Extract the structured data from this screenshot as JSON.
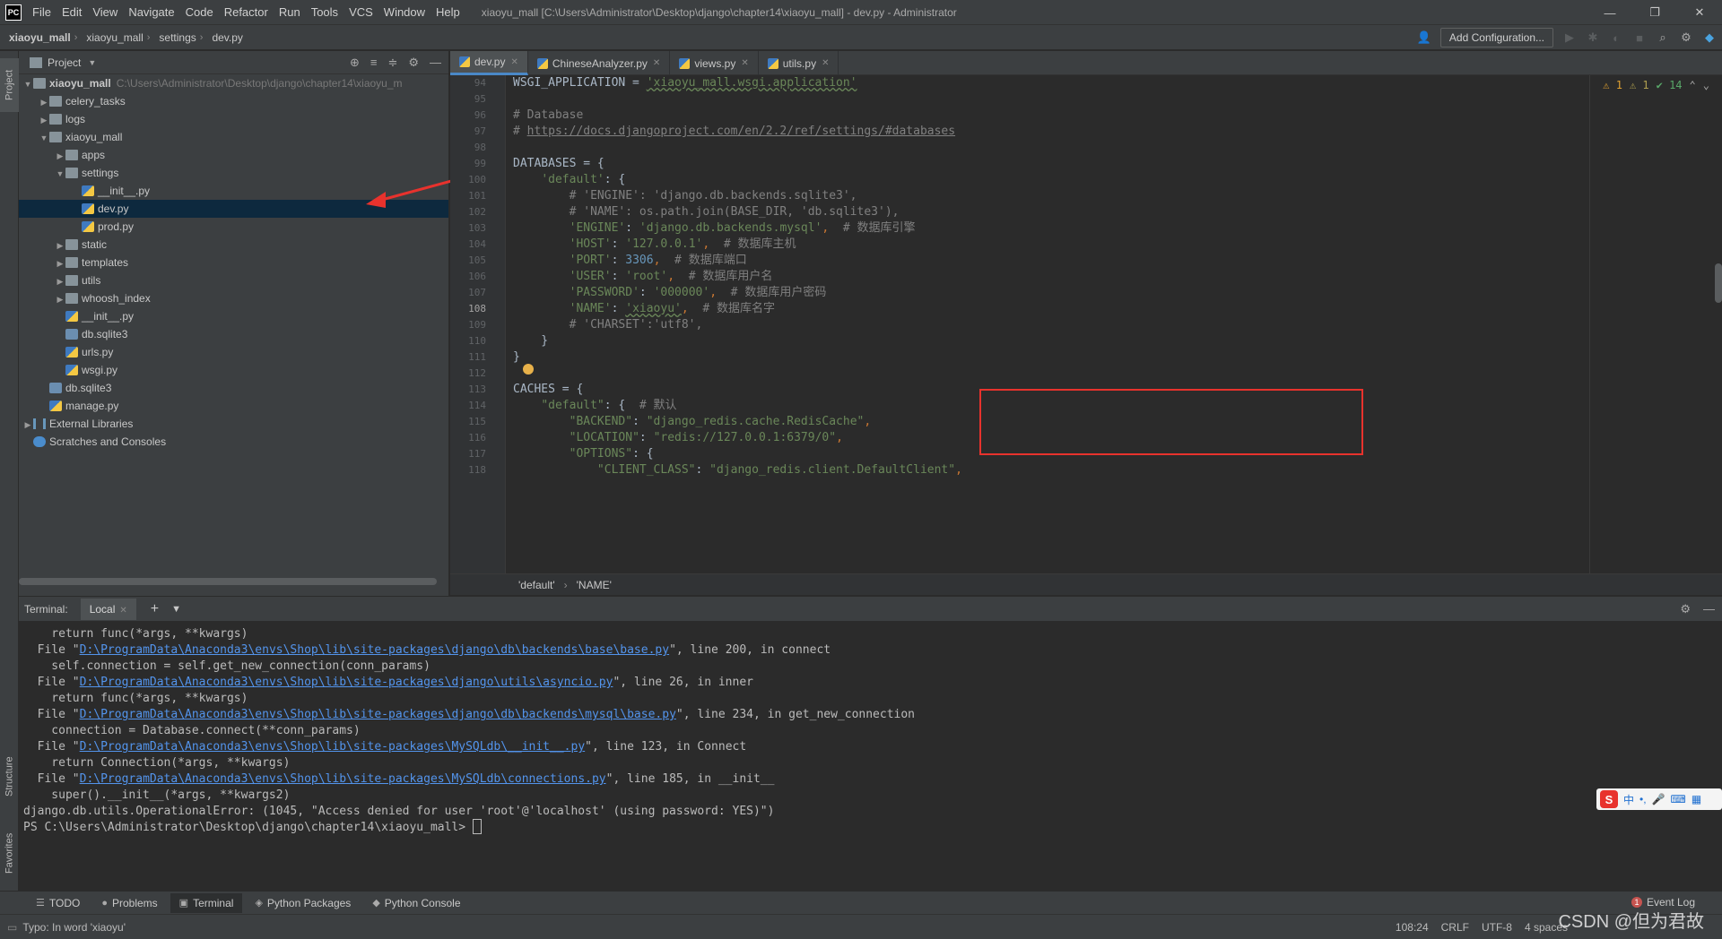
{
  "titlebar": {
    "menu": [
      "File",
      "Edit",
      "View",
      "Navigate",
      "Code",
      "Refactor",
      "Run",
      "Tools",
      "VCS",
      "Window",
      "Help"
    ],
    "window_title": "xiaoyu_mall [C:\\Users\\Administrator\\Desktop\\django\\chapter14\\xiaoyu_mall] - dev.py - Administrator",
    "logo": "PC"
  },
  "navbar": {
    "crumbs": [
      "xiaoyu_mall",
      "xiaoyu_mall",
      "settings",
      "dev.py"
    ],
    "add_configuration": "Add Configuration..."
  },
  "left_stripe": {
    "project": "Project",
    "structure": "Structure",
    "favorites": "Favorites"
  },
  "project": {
    "title": "Project",
    "root_path": "C:\\Users\\Administrator\\Desktop\\django\\chapter14\\xiaoyu_m",
    "tree": [
      {
        "label": "xiaoyu_mall",
        "depth": 0,
        "arrow": "down",
        "icon": "folder",
        "bold": true
      },
      {
        "label": "celery_tasks",
        "depth": 1,
        "arrow": "right",
        "icon": "folder"
      },
      {
        "label": "logs",
        "depth": 1,
        "arrow": "right",
        "icon": "folder"
      },
      {
        "label": "xiaoyu_mall",
        "depth": 1,
        "arrow": "down",
        "icon": "folder"
      },
      {
        "label": "apps",
        "depth": 2,
        "arrow": "right",
        "icon": "folder"
      },
      {
        "label": "settings",
        "depth": 2,
        "arrow": "down",
        "icon": "folder"
      },
      {
        "label": "__init__.py",
        "depth": 3,
        "arrow": "",
        "icon": "py"
      },
      {
        "label": "dev.py",
        "depth": 3,
        "arrow": "",
        "icon": "py",
        "selected": true
      },
      {
        "label": "prod.py",
        "depth": 3,
        "arrow": "",
        "icon": "py"
      },
      {
        "label": "static",
        "depth": 2,
        "arrow": "right",
        "icon": "folder"
      },
      {
        "label": "templates",
        "depth": 2,
        "arrow": "right",
        "icon": "folder"
      },
      {
        "label": "utils",
        "depth": 2,
        "arrow": "right",
        "icon": "folder"
      },
      {
        "label": "whoosh_index",
        "depth": 2,
        "arrow": "right",
        "icon": "folder"
      },
      {
        "label": "__init__.py",
        "depth": 2,
        "arrow": "",
        "icon": "py"
      },
      {
        "label": "db.sqlite3",
        "depth": 2,
        "arrow": "",
        "icon": "db"
      },
      {
        "label": "urls.py",
        "depth": 2,
        "arrow": "",
        "icon": "py"
      },
      {
        "label": "wsgi.py",
        "depth": 2,
        "arrow": "",
        "icon": "py"
      },
      {
        "label": "db.sqlite3",
        "depth": 1,
        "arrow": "",
        "icon": "db"
      },
      {
        "label": "manage.py",
        "depth": 1,
        "arrow": "",
        "icon": "py"
      },
      {
        "label": "External Libraries",
        "depth": 0,
        "arrow": "right",
        "icon": "lib"
      },
      {
        "label": "Scratches and Consoles",
        "depth": 0,
        "arrow": "",
        "icon": "scratch"
      }
    ]
  },
  "editor": {
    "tabs": [
      {
        "label": "dev.py",
        "active": true
      },
      {
        "label": "ChineseAnalyzer.py",
        "active": false
      },
      {
        "label": "views.py",
        "active": false
      },
      {
        "label": "utils.py",
        "active": false
      }
    ],
    "inspections": {
      "warnings": "1",
      "weak": "1",
      "ok": "14"
    },
    "current_line": "108",
    "lines": [
      {
        "n": "94",
        "segs": [
          [
            "WSGI_APPLICATION = ",
            ""
          ],
          [
            "'xiaoyu_mall.wsgi.application'",
            "str-u"
          ]
        ]
      },
      {
        "n": "95",
        "segs": []
      },
      {
        "n": "96",
        "segs": [
          [
            "# Database",
            "com"
          ]
        ]
      },
      {
        "n": "97",
        "segs": [
          [
            "# ",
            "com"
          ],
          [
            "https://docs.djangoproject.com/en/2.2/ref/settings/#databases",
            "link"
          ]
        ]
      },
      {
        "n": "98",
        "segs": []
      },
      {
        "n": "99",
        "segs": [
          [
            "DATABASES = {",
            ""
          ]
        ]
      },
      {
        "n": "100",
        "segs": [
          [
            "    ",
            ""
          ],
          [
            "'default'",
            "str"
          ],
          [
            ": {",
            ""
          ]
        ]
      },
      {
        "n": "101",
        "segs": [
          [
            "        # 'ENGINE': 'django.db.backends.sqlite3',",
            "com"
          ]
        ]
      },
      {
        "n": "102",
        "segs": [
          [
            "        # 'NAME': os.path.join(BASE_DIR, 'db.sqlite3'),",
            "com"
          ]
        ]
      },
      {
        "n": "103",
        "segs": [
          [
            "        ",
            ""
          ],
          [
            "'ENGINE'",
            "str"
          ],
          [
            ": ",
            ""
          ],
          [
            "'django.db.backends.mysql'",
            "str"
          ],
          [
            ",  ",
            "kw"
          ],
          [
            "# 数据库引擎",
            "com"
          ]
        ]
      },
      {
        "n": "104",
        "segs": [
          [
            "        ",
            ""
          ],
          [
            "'HOST'",
            "str"
          ],
          [
            ": ",
            ""
          ],
          [
            "'127.0.0.1'",
            "str"
          ],
          [
            ",  ",
            "kw"
          ],
          [
            "# 数据库主机",
            "com"
          ]
        ]
      },
      {
        "n": "105",
        "segs": [
          [
            "        ",
            ""
          ],
          [
            "'PORT'",
            "str"
          ],
          [
            ": ",
            ""
          ],
          [
            "3306",
            "num"
          ],
          [
            ",  ",
            "kw"
          ],
          [
            "# 数据库端口",
            "com"
          ]
        ]
      },
      {
        "n": "106",
        "segs": [
          [
            "        ",
            ""
          ],
          [
            "'USER'",
            "str"
          ],
          [
            ": ",
            ""
          ],
          [
            "'root'",
            "str"
          ],
          [
            ",  ",
            "kw"
          ],
          [
            "# 数据库用户名",
            "com"
          ]
        ]
      },
      {
        "n": "107",
        "segs": [
          [
            "        ",
            ""
          ],
          [
            "'PASSWORD'",
            "str"
          ],
          [
            ": ",
            ""
          ],
          [
            "'000000'",
            "str"
          ],
          [
            ",  ",
            "kw"
          ],
          [
            "# 数据库用户密码",
            "com"
          ]
        ]
      },
      {
        "n": "108",
        "segs": [
          [
            "        ",
            ""
          ],
          [
            "'NAME'",
            "str"
          ],
          [
            ": ",
            ""
          ],
          [
            "'xiaoyu'",
            "str-u"
          ],
          [
            ",  ",
            "kw"
          ],
          [
            "# 数据库名字",
            "com"
          ]
        ]
      },
      {
        "n": "109",
        "segs": [
          [
            "        # 'CHARSET':'utf8',",
            "com"
          ]
        ]
      },
      {
        "n": "110",
        "segs": [
          [
            "    }",
            ""
          ]
        ]
      },
      {
        "n": "111",
        "segs": [
          [
            "}",
            ""
          ]
        ]
      },
      {
        "n": "112",
        "segs": []
      },
      {
        "n": "113",
        "segs": [
          [
            "CACHES = {",
            ""
          ]
        ]
      },
      {
        "n": "114",
        "segs": [
          [
            "    ",
            ""
          ],
          [
            "\"default\"",
            "str"
          ],
          [
            ": {  ",
            ""
          ],
          [
            "# 默认",
            "com"
          ]
        ]
      },
      {
        "n": "115",
        "segs": [
          [
            "        ",
            ""
          ],
          [
            "\"BACKEND\"",
            "str"
          ],
          [
            ": ",
            ""
          ],
          [
            "\"django_redis.cache.RedisCache\"",
            "str"
          ],
          [
            ",",
            "kw"
          ]
        ]
      },
      {
        "n": "116",
        "segs": [
          [
            "        ",
            ""
          ],
          [
            "\"LOCATION\"",
            "str"
          ],
          [
            ": ",
            ""
          ],
          [
            "\"redis://127.0.0.1:6379/0\"",
            "str"
          ],
          [
            ",",
            "kw"
          ]
        ]
      },
      {
        "n": "117",
        "segs": [
          [
            "        ",
            ""
          ],
          [
            "\"OPTIONS\"",
            "str"
          ],
          [
            ": {",
            ""
          ]
        ]
      },
      {
        "n": "118",
        "segs": [
          [
            "            ",
            ""
          ],
          [
            "\"CLIENT_CLASS\"",
            "str"
          ],
          [
            ": ",
            ""
          ],
          [
            "\"django_redis.client.DefaultClient\"",
            "str"
          ],
          [
            ",",
            "kw"
          ]
        ]
      }
    ],
    "breadcrumb": [
      "'default'",
      "'NAME'"
    ]
  },
  "terminal": {
    "label": "Terminal:",
    "tab": "Local",
    "lines": [
      [
        [
          "    return func(*args, **kwargs)",
          ""
        ]
      ],
      [
        [
          "  File \"",
          ""
        ],
        [
          "D:\\ProgramData\\Anaconda3\\envs\\Shop\\lib\\site-packages\\django\\db\\backends\\base\\base.py",
          "link"
        ],
        [
          "\", line 200, in connect",
          ""
        ]
      ],
      [
        [
          "    self.connection = self.get_new_connection(conn_params)",
          ""
        ]
      ],
      [
        [
          "  File \"",
          ""
        ],
        [
          "D:\\ProgramData\\Anaconda3\\envs\\Shop\\lib\\site-packages\\django\\utils\\asyncio.py",
          "link"
        ],
        [
          "\", line 26, in inner",
          ""
        ]
      ],
      [
        [
          "    return func(*args, **kwargs)",
          ""
        ]
      ],
      [
        [
          "  File \"",
          ""
        ],
        [
          "D:\\ProgramData\\Anaconda3\\envs\\Shop\\lib\\site-packages\\django\\db\\backends\\mysql\\base.py",
          "link"
        ],
        [
          "\", line 234, in get_new_connection",
          ""
        ]
      ],
      [
        [
          "    connection = Database.connect(**conn_params)",
          ""
        ]
      ],
      [
        [
          "  File \"",
          ""
        ],
        [
          "D:\\ProgramData\\Anaconda3\\envs\\Shop\\lib\\site-packages\\MySQLdb\\__init__.py",
          "link"
        ],
        [
          "\", line 123, in Connect",
          ""
        ]
      ],
      [
        [
          "    return Connection(*args, **kwargs)",
          ""
        ]
      ],
      [
        [
          "  File \"",
          ""
        ],
        [
          "D:\\ProgramData\\Anaconda3\\envs\\Shop\\lib\\site-packages\\MySQLdb\\connections.py",
          "link"
        ],
        [
          "\", line 185, in __init__",
          ""
        ]
      ],
      [
        [
          "    super().__init__(*args, **kwargs2)",
          ""
        ]
      ],
      [
        [
          "django.db.utils.OperationalError: (1045, \"Access denied for user 'root'@'localhost' (using password: YES)\")",
          ""
        ]
      ],
      [
        [
          "PS C:\\Users\\Administrator\\Desktop\\django\\chapter14\\xiaoyu_mall> ",
          ""
        ],
        [
          "",
          "cursor"
        ]
      ]
    ]
  },
  "bottom_tools": {
    "items": [
      {
        "label": "TODO",
        "icon": "☰"
      },
      {
        "label": "Problems",
        "icon": "●"
      },
      {
        "label": "Terminal",
        "icon": "▣",
        "active": true
      },
      {
        "label": "Python Packages",
        "icon": "◈"
      },
      {
        "label": "Python Console",
        "icon": "◆"
      }
    ],
    "event_log": "Event Log",
    "event_count": "1"
  },
  "statusbar": {
    "message": "Typo: In word 'xiaoyu'",
    "position": "108:24",
    "line_sep": "CRLF",
    "encoding": "UTF-8",
    "indent": "4 spaces"
  },
  "watermark": "CSDN @但为君故",
  "ime": {
    "mode": "中"
  },
  "colors": {
    "accent": "#4a88c7",
    "highlight": "#e8322d",
    "selection": "#0d293e"
  }
}
